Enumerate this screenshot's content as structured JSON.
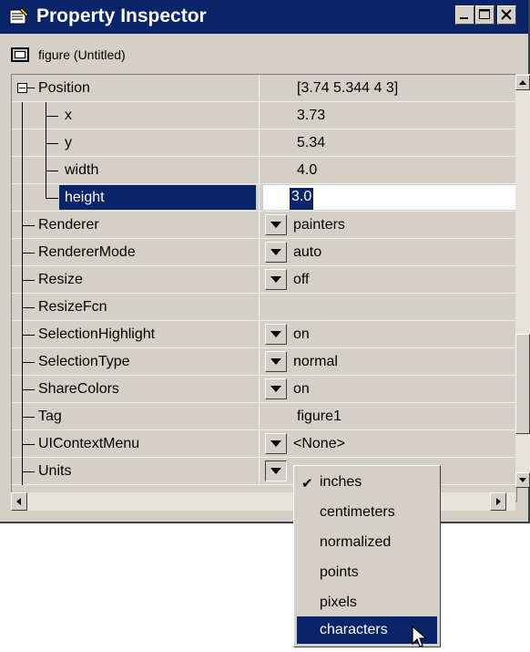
{
  "window": {
    "title": "Property Inspector",
    "object_label": "figure (Untitled)"
  },
  "rows": [
    {
      "name": "Position",
      "value": "[3.74 5.344 4 3]"
    },
    {
      "name": "x",
      "value": "3.73"
    },
    {
      "name": "y",
      "value": "5.34"
    },
    {
      "name": "width",
      "value": "4.0"
    },
    {
      "name": "height",
      "value": "3.0"
    },
    {
      "name": "Renderer",
      "value": "painters"
    },
    {
      "name": "RendererMode",
      "value": "auto"
    },
    {
      "name": "Resize",
      "value": "off"
    },
    {
      "name": "ResizeFcn",
      "value": ""
    },
    {
      "name": "SelectionHighlight",
      "value": "on"
    },
    {
      "name": "SelectionType",
      "value": "normal"
    },
    {
      "name": "ShareColors",
      "value": "on"
    },
    {
      "name": "Tag",
      "value": "figure1"
    },
    {
      "name": "UIContextMenu",
      "value": "<None>"
    },
    {
      "name": "Units",
      "value": ""
    }
  ],
  "units_dropdown": {
    "options": [
      "inches",
      "centimeters",
      "normalized",
      "points",
      "pixels",
      "characters"
    ],
    "checked": "inches",
    "highlighted": "characters"
  },
  "colors": {
    "titlebar": "#0a246a",
    "selection": "#0a246a",
    "face": "#d4d0c8"
  }
}
